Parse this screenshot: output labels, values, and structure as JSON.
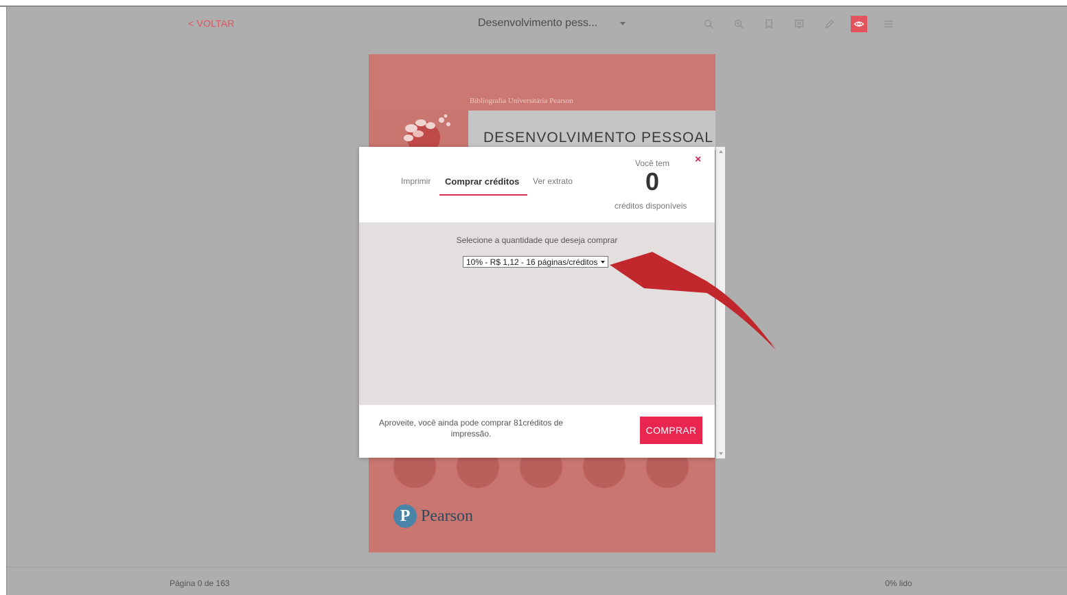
{
  "toolbar": {
    "back_label": "< VOLTAR",
    "book_title": "Desenvolvimento pess...",
    "tools": [
      "search-icon",
      "zoom-in-icon",
      "bookmark-icon",
      "notes-icon",
      "pencil-icon",
      "eye-icon",
      "menu-icon"
    ],
    "active_tool": "eye-icon",
    "accent_color": "#e2535b"
  },
  "cover": {
    "series": "Bibliografia Universitária Pearson",
    "title": "DESENVOLVIMENTO PESSOAL",
    "publisher": "Pearson",
    "publisher_mark": "P",
    "background_color": "#c97570"
  },
  "modal": {
    "tabs": [
      "Imprimir",
      "Comprar créditos",
      "Ver extrato"
    ],
    "active_tab": "Comprar créditos",
    "close_label": "×",
    "credits_caption": "Você tem",
    "credits_value": "0",
    "credits_sub": "créditos disponíveis",
    "select_prompt": "Selecione a quantidade que deseja comprar",
    "quantity_selected": "10% - R$ 1,12 - 16 páginas/créditos",
    "promo_text": "Aproveite, você ainda pode comprar 81créditos de impressão.",
    "buy_label": "COMPRAR",
    "buy_color": "#e9264f"
  },
  "status": {
    "page_indicator": "Página 0 de 163",
    "read_progress": "0% lido"
  }
}
